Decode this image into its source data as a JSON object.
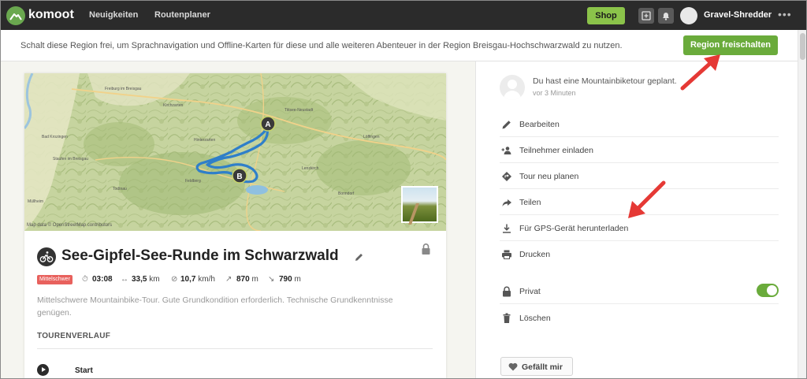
{
  "nav": {
    "brand": "komoot",
    "links": [
      "Neuigkeiten",
      "Routenplaner"
    ],
    "shop_label": "Shop",
    "username": "Gravel-Shredder",
    "more": "•••"
  },
  "banner": {
    "text": "Schalt diese Region frei, um Sprachnavigation und Offline-Karten für diese und alle weiteren Abenteuer in der Region Breisgau-Hochschwarzwald zu nutzen.",
    "button_label": "Region freischalten"
  },
  "map": {
    "credit": "Map data © OpenStreetMap contributors",
    "cities": [
      "Freiburg im Breisgau",
      "Kirchzarten",
      "Bad Krozingen",
      "Staufen im Breisgau",
      "Müllheim",
      "Hinterzarten",
      "Lenzkirch",
      "Feldberg",
      "Todtnau",
      "Bonndorf",
      "Titisee-Neustadt",
      "Löffingen"
    ],
    "marker_start": "A",
    "marker_end": "B",
    "colors": {
      "route": "#2f7fc9",
      "marker": "#3a3a3a"
    }
  },
  "tour": {
    "title": "See-Gipfel-See-Runde im Schwarzwald",
    "difficulty": "Mittelschwer",
    "duration": "03:08",
    "distance": "33,5",
    "distance_unit": "km",
    "speed": "10,7",
    "speed_unit": "km/h",
    "ascent": "870",
    "ascent_unit": "m",
    "descent": "790",
    "descent_unit": "m",
    "description": "Mittelschwere Mountainbike-Tour. Gute Grundkondition erforderlich. Technische Grundkenntnisse genügen.",
    "section_title": "TOURENVERLAUF",
    "start_label": "Start"
  },
  "panel": {
    "notice": "Du hast eine Mountainbiketour geplant.",
    "notice_time": "vor 3 Minuten",
    "actions": [
      {
        "label": "Bearbeiten",
        "icon": "pencil-icon"
      },
      {
        "label": "Teilnehmer einladen",
        "icon": "add-people-icon"
      },
      {
        "label": "Tour neu planen",
        "icon": "route-diamond-icon"
      },
      {
        "label": "Teilen",
        "icon": "share-arrow-icon"
      },
      {
        "label": "Für GPS-Gerät herunterladen",
        "icon": "download-icon"
      },
      {
        "label": "Drucken",
        "icon": "printer-icon"
      }
    ],
    "private_label": "Privat",
    "delete_label": "Löschen",
    "like_label": "Gefällt mir"
  },
  "colors": {
    "accent_green": "#6aab3b",
    "shop_green": "#8bc34a",
    "difficulty_red": "#e8615d",
    "annotation_red": "#e53935"
  }
}
